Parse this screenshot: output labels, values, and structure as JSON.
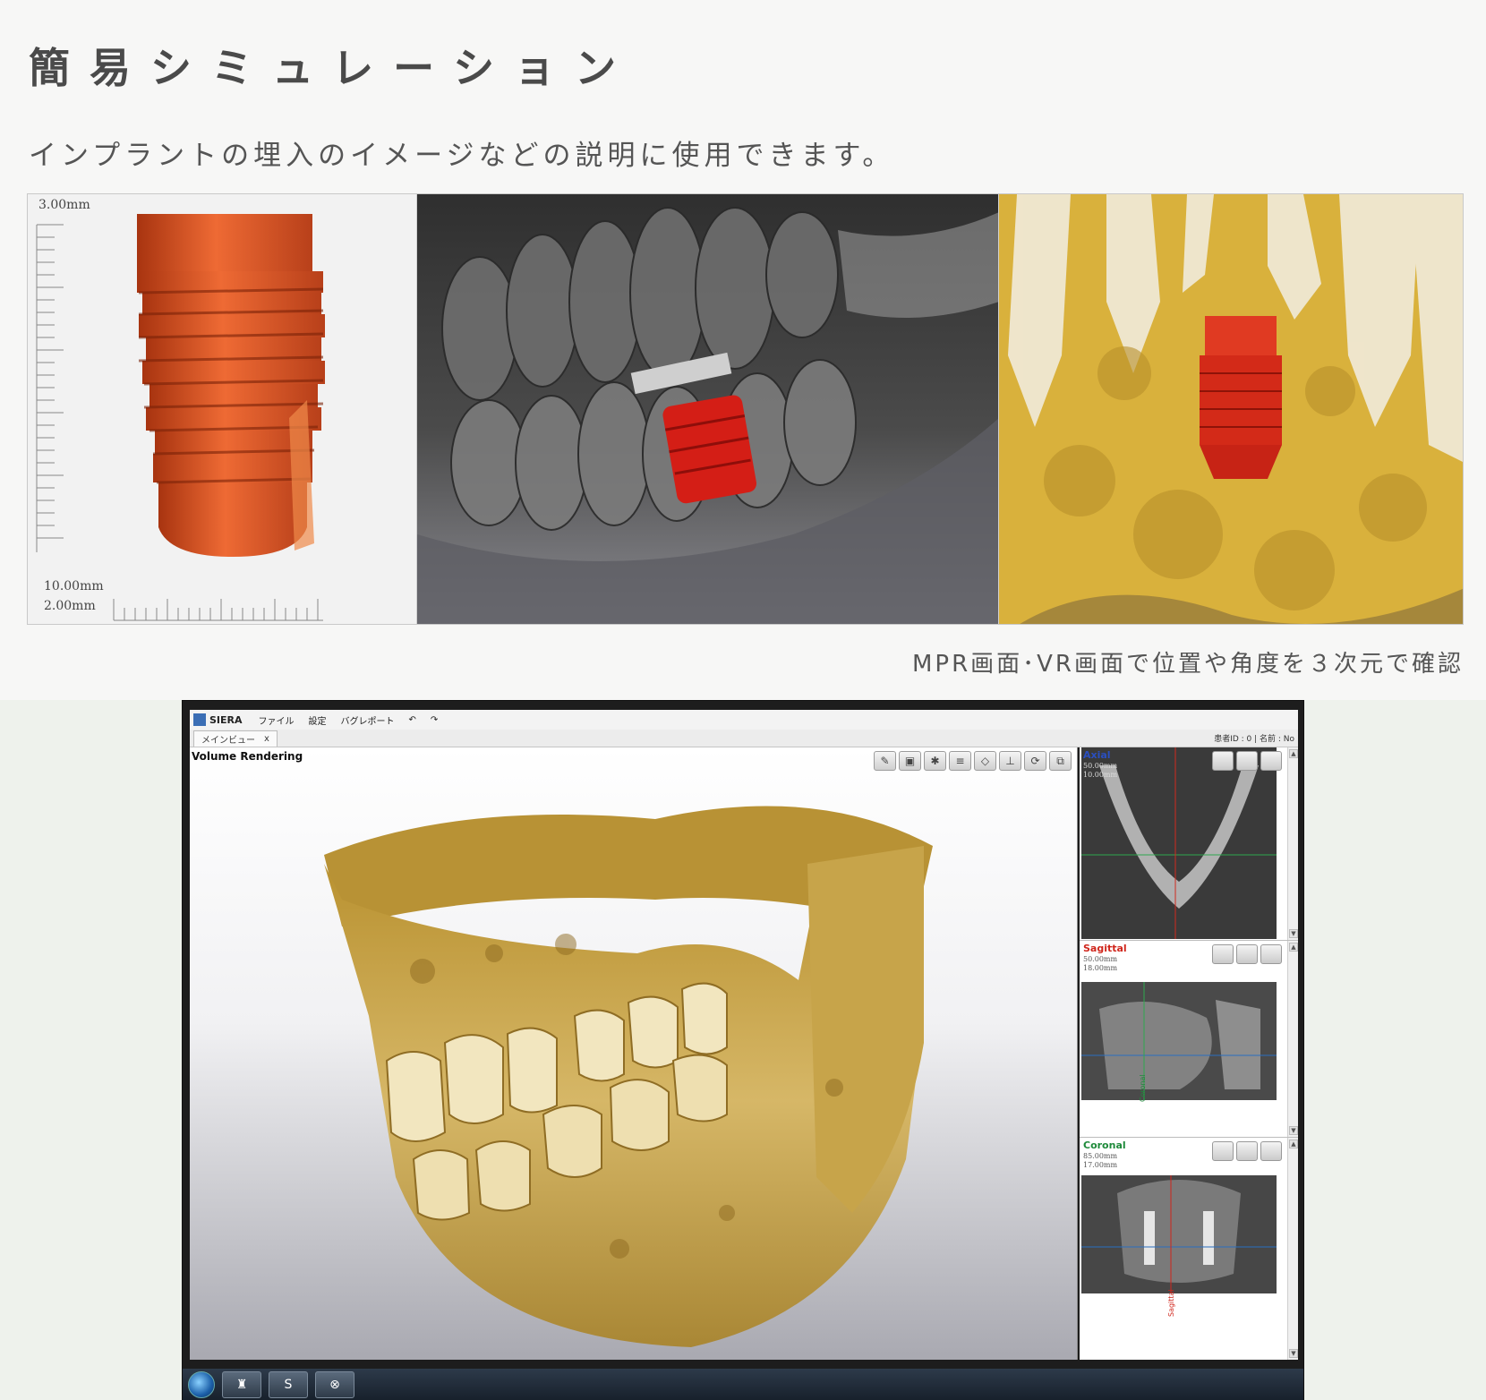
{
  "header": {
    "title": "簡易シミュレーション",
    "subtitle": "インプラントの埋入のイメージなどの説明に使用できます。"
  },
  "strip": {
    "scale_top": "3.00mm",
    "scale_bottom_1": "10.00mm",
    "scale_bottom_2": "2.00mm"
  },
  "caption": "MPR画面･VR画面で位置や角度を３次元で確認",
  "window": {
    "app_name": "SIERA",
    "menu": [
      "ファイル",
      "設定",
      "バグレポート"
    ],
    "tab_label": "メインビュー",
    "tab_close": "x",
    "patient_info": "患者ID : 0 | 名前 : No",
    "viewport_label": "Volume Rendering",
    "views": [
      {
        "name": "Axial",
        "line1": "50.00mm",
        "line2": "10.00mm",
        "color": "#2a4fc0"
      },
      {
        "name": "Sagittal",
        "line1": "50.00mm",
        "line2": "18.00mm",
        "color": "#d0261c"
      },
      {
        "name": "Coronal",
        "line1": "85.00mm",
        "line2": "17.00mm",
        "color": "#1e8a3a"
      }
    ],
    "axis_labels": {
      "coronal": "Coronal",
      "axial": "Axial",
      "sagittal": "Sagittal"
    }
  },
  "colors": {
    "implant": "#d9531e",
    "implant_red": "#d41e16",
    "bone_gold": "#c8a24a",
    "lower_bg": "#eef2ec"
  }
}
